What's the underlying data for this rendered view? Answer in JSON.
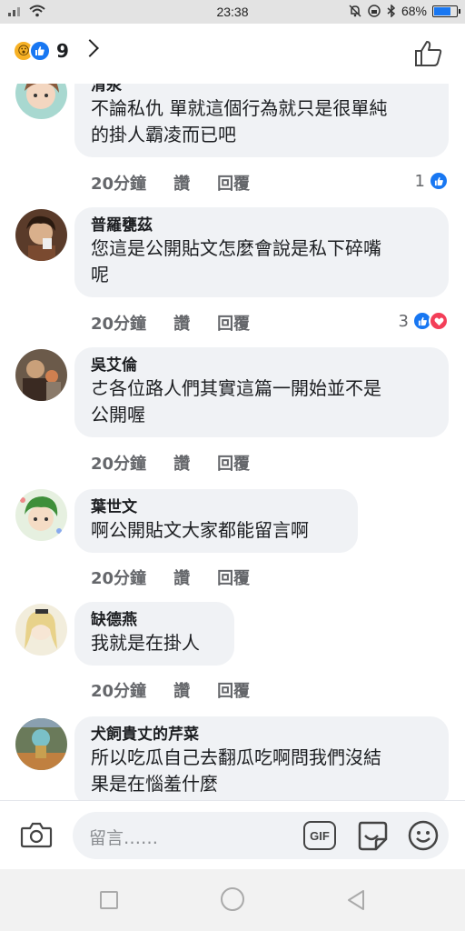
{
  "status_bar": {
    "time": "23:38",
    "battery": "68%",
    "battery_level": 0.68,
    "left_icons": [
      "signal-icon",
      "wifi-icon"
    ],
    "right_icons": [
      "bell-mute-icon",
      "lock-icon",
      "bluetooth-icon"
    ]
  },
  "header": {
    "reaction_count": "9",
    "reactions": [
      "wow",
      "like"
    ]
  },
  "comments": [
    {
      "name": "清汞",
      "text": [
        "不論私仇 單就這個行為就只是很單純",
        "的掛人霸凌而已吧"
      ],
      "time": "20分鐘",
      "like": "讚",
      "reply": "回覆",
      "reaction_count": "1",
      "reactions": [
        "like"
      ]
    },
    {
      "name": "普羅甕茲",
      "text": [
        "您這是公開貼文怎麼會說是私下碎嘴",
        "呢"
      ],
      "time": "20分鐘",
      "like": "讚",
      "reply": "回覆",
      "reaction_count": "3",
      "reactions": [
        "like",
        "love"
      ]
    },
    {
      "name": "吳艾倫",
      "text": [
        "ㄜ各位路人們其實這篇一開始並不是",
        "公開喔"
      ],
      "time": "20分鐘",
      "like": "讚",
      "reply": "回覆"
    },
    {
      "name": "葉世文",
      "text": [
        "啊公開貼文大家都能留言啊"
      ],
      "time": "20分鐘",
      "like": "讚",
      "reply": "回覆"
    },
    {
      "name": "缺德燕",
      "text": [
        "我就是在掛人"
      ],
      "time": "20分鐘",
      "like": "讚",
      "reply": "回覆"
    },
    {
      "name": "犬飼貴丈的芹菜",
      "text": [
        "所以吃瓜自己去翻瓜吃啊問我們沒結",
        "果是在惱羞什麼"
      ]
    }
  ],
  "input_bar": {
    "placeholder": "留言……",
    "gif_label": "GIF"
  },
  "colors": {
    "accent": "#1877f2",
    "love": "#f33e58",
    "bubble": "#f0f2f5",
    "meta_text": "#65676b"
  }
}
